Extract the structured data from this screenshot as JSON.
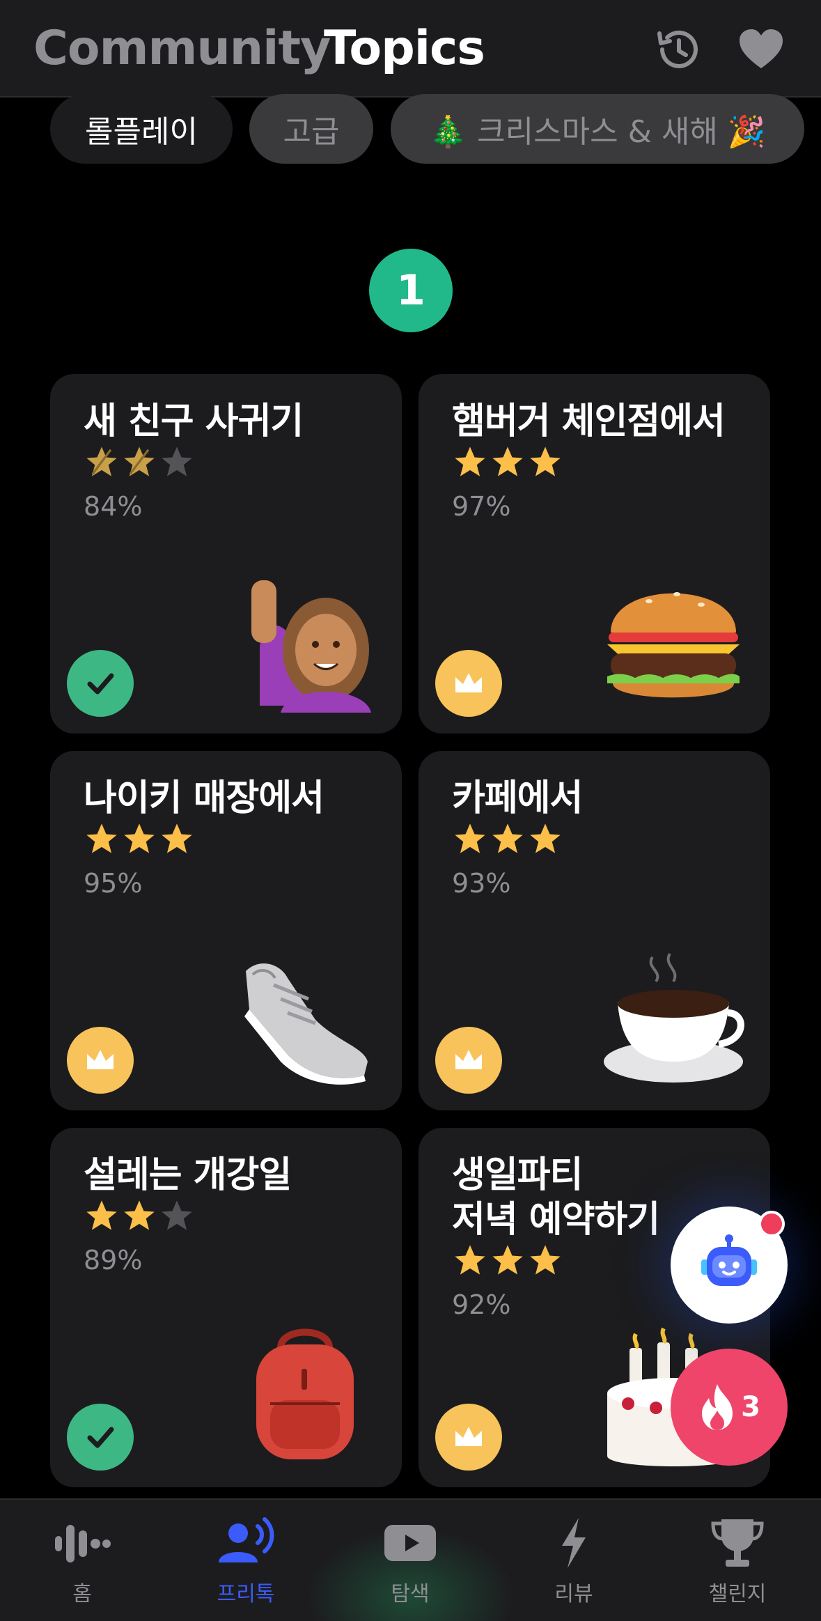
{
  "header": {
    "tabs": [
      {
        "label": "Community",
        "active": false
      },
      {
        "label": "Topics",
        "active": true
      }
    ],
    "icons": [
      "history-icon",
      "heart-icon"
    ]
  },
  "chips": [
    {
      "label": "롤플레이",
      "selected": true
    },
    {
      "label": "고급",
      "selected": false
    },
    {
      "label": "🎄 크리스마스 & 새해 🎉",
      "selected": false
    }
  ],
  "level": "1",
  "cards": [
    {
      "title": "새 친구 사귀기",
      "rating": 2,
      "percent": "84%",
      "illustration": "woman-raising-hand",
      "status": "completed"
    },
    {
      "title": "햄버거 체인점에서",
      "rating": 3,
      "percent": "97%",
      "illustration": "hamburger",
      "status": "crown"
    },
    {
      "title": "나이키 매장에서",
      "rating": 3,
      "percent": "95%",
      "illustration": "sneaker",
      "status": "crown"
    },
    {
      "title": "카페에서",
      "rating": 3,
      "percent": "93%",
      "illustration": "hot-coffee",
      "status": "crown"
    },
    {
      "title": "설레는 개강일",
      "rating": 2,
      "percent": "89%",
      "illustration": "backpack",
      "status": "completed"
    },
    {
      "title": "생일파티\n저녁 예약하기",
      "rating": 3,
      "percent": "92%",
      "illustration": "birthday-cake",
      "status": "crown"
    }
  ],
  "fab": {
    "bot_icon": "robot-icon",
    "streak_count": "3"
  },
  "bottom_nav": [
    {
      "label": "홈",
      "icon": "voice-wave-icon",
      "active": false
    },
    {
      "label": "프리톡",
      "icon": "person-talk-icon",
      "active": true
    },
    {
      "label": "탐색",
      "icon": "play-icon",
      "active": false
    },
    {
      "label": "리뷰",
      "icon": "lightning-icon",
      "active": false
    },
    {
      "label": "챌린지",
      "icon": "trophy-icon",
      "active": false
    }
  ],
  "colors": {
    "accent_blue": "#3b5bfa",
    "green": "#22b98a",
    "star": "#fcbf49",
    "crown_bg": "#f7c35a",
    "done_bg": "#3db884",
    "fire": "#f0456a"
  }
}
